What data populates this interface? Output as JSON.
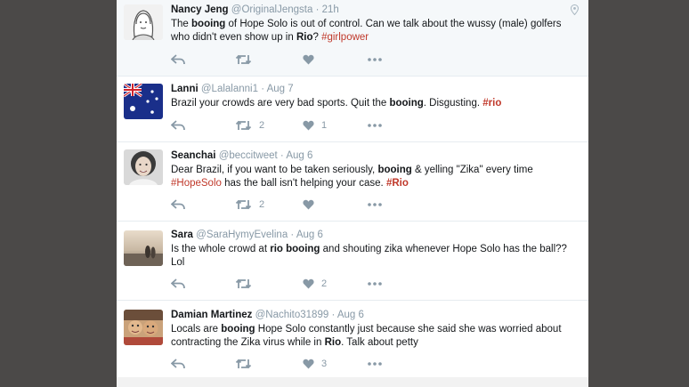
{
  "tweets": [
    {
      "name": "Nancy Jeng",
      "handle": "@OriginalJengsta",
      "dot": "·",
      "time": "21h",
      "text_segments": [
        "The ",
        "booing",
        " of Hope Solo is out of control. Can we talk about the wussy (male) golfers who didn't even show up in ",
        "Rio",
        "? ",
        "#girlpower"
      ],
      "retweets": "",
      "likes": ""
    },
    {
      "name": "Lanni",
      "handle": "@Lalalanni1",
      "dot": "·",
      "time": "Aug 7",
      "text_segments": [
        "Brazil your crowds are very bad sports. Quit the ",
        "booing",
        ". Disgusting. ",
        "#rio"
      ],
      "retweets": "2",
      "likes": "1"
    },
    {
      "name": "Seanchai",
      "handle": "@beccitweet",
      "dot": "·",
      "time": "Aug 6",
      "text_segments": [
        "Dear Brazil, if you want to be taken seriously, ",
        "booing",
        " & yelling \"Zika\" every time ",
        "#HopeSolo",
        " has the ball isn't helping your case. ",
        "#Rio"
      ],
      "retweets": "2",
      "likes": ""
    },
    {
      "name": "Sara",
      "handle": "@SaraHymyEvelina",
      "dot": "·",
      "time": "Aug 6",
      "text_segments": [
        "Is the whole crowd at ",
        "rio booing",
        " and shouting zika whenever Hope Solo has the ball?? Lol"
      ],
      "retweets": "",
      "likes": "2"
    },
    {
      "name": "Damian Martinez",
      "handle": "@Nachito31899",
      "dot": "·",
      "time": "Aug 6",
      "text_segments": [
        "Locals are ",
        "booing",
        " Hope Solo constantly just because she said she was worried about contracting the Zika virus while in ",
        "Rio",
        ". Talk about petty"
      ],
      "retweets": "",
      "likes": "3"
    }
  ],
  "icons": {
    "reply": "reply-icon",
    "retweet": "retweet-icon",
    "like": "heart-icon",
    "more": "more-icon",
    "location": "location-pin-icon"
  },
  "colors": {
    "hashtag": "#c0392b",
    "icon": "#8899a6",
    "background": "#4b4948"
  }
}
